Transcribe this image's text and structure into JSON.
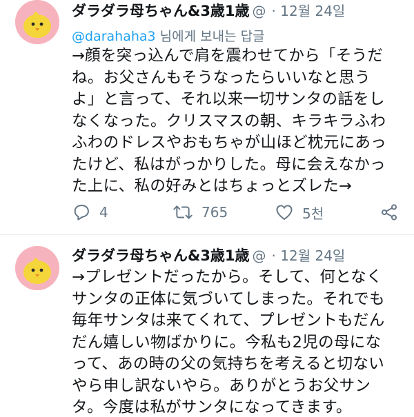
{
  "colors": {
    "avatar_bg": "#f7b3bd",
    "chick": "#f5d63a",
    "link": "#1da1f2",
    "muted": "#657786"
  },
  "tweets": [
    {
      "author": "ダラダラ母ちゃん&3歳1歳",
      "handle_ellipsis": "@",
      "timestamp": "· 12월 24일",
      "reply_to_handle": "@darahaha3",
      "reply_to_suffix": " 님에게 보내는 답글",
      "lines": [
        "→顔を突っ込んで肩を震わせてから「そうだ",
        "ね。お父さんもそうなったらいいなと思う",
        "よ」と言って、それ以来一切サンタの話をし",
        "なくなった。クリスマスの朝、キラキラふわ",
        "ふわのドレスやおもちゃが山ほど枕元にあっ",
        "たけど、私はがっかりした。母に会えなかっ",
        "た上に、私の好みとはちょっとズレた→"
      ],
      "actions": {
        "reply_icon": "reply-icon",
        "reply_count": "4",
        "retweet_icon": "retweet-icon",
        "retweet_count": "765",
        "like_icon": "heart-icon",
        "like_count": "5천",
        "share_icon": "share-icon"
      }
    },
    {
      "author": "ダラダラ母ちゃん&3歳1歳",
      "handle_ellipsis": "@",
      "timestamp": "· 12월 24일",
      "lines": [
        "→プレゼントだったから。そして、何となく",
        "サンタの正体に気づいてしまった。それでも",
        "毎年サンタは来てくれて、プレゼントもだん",
        "だん嬉しい物ばかりに。今私も2児の母にな",
        "って、あの時の父の気持ちを考えると切ない",
        "やら申し訳ないやら。ありがとうお父サン",
        "タ。今度は私がサンタになってきます。"
      ]
    }
  ]
}
